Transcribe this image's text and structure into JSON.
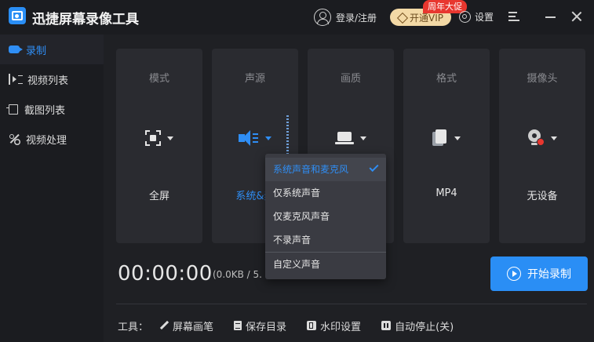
{
  "app": {
    "title": "迅捷屏幕录像工具",
    "login_label": "登录/注册",
    "vip_label": "开通VIP",
    "promo_badge": "周年大促",
    "settings_label": "设置"
  },
  "sidebar": {
    "items": [
      {
        "label": "录制",
        "icon": "record-icon",
        "active": true
      },
      {
        "label": "视频列表",
        "icon": "video-list-icon",
        "active": false
      },
      {
        "label": "截图列表",
        "icon": "screenshot-list-icon",
        "active": false
      },
      {
        "label": "视频处理",
        "icon": "video-process-icon",
        "active": false
      }
    ]
  },
  "cards": [
    {
      "title": "模式",
      "value": "全屏",
      "icon": "fullscreen-mode-icon"
    },
    {
      "title": "声源",
      "value": "系统&麦",
      "icon": "speaker-icon"
    },
    {
      "title": "画质",
      "value": "",
      "icon": "laptop-icon"
    },
    {
      "title": "格式",
      "value": "MP4",
      "icon": "file-format-icon"
    },
    {
      "title": "摄像头",
      "value": "无设备",
      "icon": "webcam-icon"
    }
  ],
  "audio_dropdown": {
    "options": [
      "系统声音和麦克风",
      "仅系统声音",
      "仅麦克风声音",
      "不录声音",
      "自定义声音"
    ],
    "selected": "系统声音和麦克风"
  },
  "recorder": {
    "timer": "00:00:00",
    "size_info": "(0.0KB / 5.",
    "start_label": "开始录制"
  },
  "tools": {
    "label": "工具：",
    "items": [
      {
        "label": "屏幕画笔",
        "icon": "pen-icon"
      },
      {
        "label": "保存目录",
        "icon": "folder-doc-icon"
      },
      {
        "label": "水印设置",
        "icon": "watermark-icon"
      },
      {
        "label": "自动停止(关)",
        "icon": "auto-stop-icon"
      }
    ]
  },
  "colors": {
    "accent": "#2f8ef5",
    "background": "#1b1c20",
    "card": "#2a2b30",
    "promo": "#e8372f",
    "vip": "#f3d9a6"
  }
}
